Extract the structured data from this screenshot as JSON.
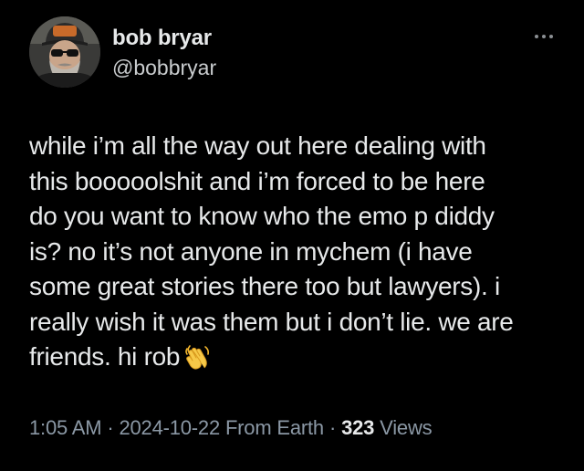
{
  "author": {
    "display_name": "bob bryar",
    "handle": "@bobbryar"
  },
  "tweet": {
    "lines": [
      "while i’m all the way out here dealing with",
      "this booooolshit and i’m forced to be here",
      "do you want to know who the emo p diddy",
      "is? no it’s not anyone in mychem (i have",
      "some great stories there too but lawyers). i",
      "really wish it was them but i don’t lie. we are",
      "friends. hi rob"
    ],
    "emoji": "waving-hand-icon"
  },
  "meta": {
    "time": "1:05 AM",
    "separator": "·",
    "date": "2024-10-22",
    "source": "From Earth",
    "views_count": "323",
    "views_label": "Views"
  },
  "colors": {
    "background": "#000000",
    "text_primary": "#e7e9ea",
    "text_secondary": "#8b98a5"
  }
}
